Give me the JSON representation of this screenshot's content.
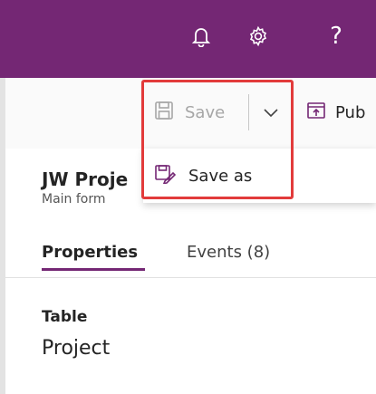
{
  "colors": {
    "topbar": "#742774",
    "accent": "#742774",
    "highlight": "#e23b3b",
    "disabled_text": "#a6a6a6"
  },
  "topbar": {
    "icons": [
      "bell-icon",
      "gear-icon",
      "help-icon"
    ],
    "help_glyph": "?"
  },
  "toolbar": {
    "save_label": "Save",
    "save_disabled": true,
    "publish_label": "Pub"
  },
  "save_menu": {
    "items": [
      {
        "label": "Save as",
        "icon": "save-as-icon"
      }
    ]
  },
  "form": {
    "title": "JW Proje",
    "subtitle": "Main form",
    "tabs": [
      {
        "label": "Properties",
        "active": true
      },
      {
        "label": "Events (8)",
        "active": false
      }
    ],
    "fields": [
      {
        "label": "Table",
        "value": "Project"
      }
    ]
  }
}
